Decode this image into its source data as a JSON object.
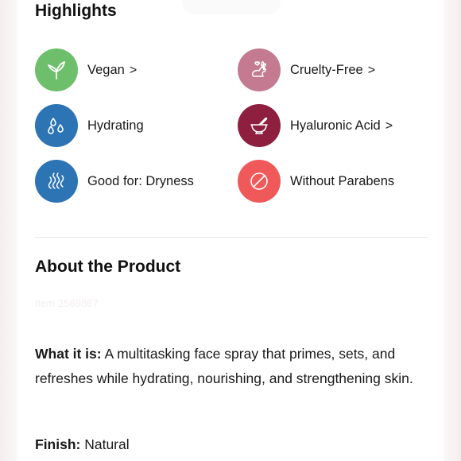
{
  "highlights": {
    "title": "Highlights",
    "items": [
      {
        "label": "Vegan",
        "link": true,
        "icon": "sprout-icon",
        "color": "#6dbf6b"
      },
      {
        "label": "Cruelty-Free",
        "link": true,
        "icon": "bunny-icon",
        "color": "#c47a90"
      },
      {
        "label": "Hydrating",
        "link": false,
        "icon": "droplets-icon",
        "color": "#2c74b3"
      },
      {
        "label": "Hyaluronic Acid",
        "link": true,
        "icon": "mortar-pestle-icon",
        "color": "#8e1f3f"
      },
      {
        "label": "Good for: Dryness",
        "link": false,
        "icon": "heat-waves-icon",
        "color": "#2c74b3"
      },
      {
        "label": "Without Parabens",
        "link": false,
        "icon": "prohibited-icon",
        "color": "#f0595a"
      }
    ],
    "chevron": ">"
  },
  "about": {
    "title": "About the Product",
    "item_number": "Item 2569867",
    "what_it_is_label": "What it is:",
    "what_it_is_text": " A multitasking face spray that primes, sets, and refreshes while hydrating, nourishing, and strengthening skin.",
    "finish_label": "Finish:",
    "finish_value": " Natural"
  }
}
